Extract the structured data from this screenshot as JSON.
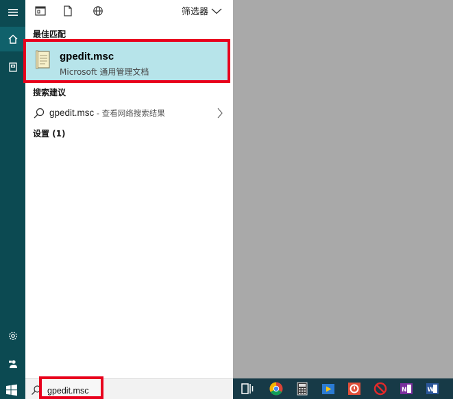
{
  "filters": {
    "label": "筛选器"
  },
  "best_match": {
    "header": "最佳匹配",
    "title": "gpedit.msc",
    "subtitle": "Microsoft 通用管理文档"
  },
  "suggestions": {
    "header": "搜索建议",
    "query": "gpedit.msc",
    "hint": " - 查看网络搜索结果"
  },
  "settings": {
    "header": "设置 (1)"
  },
  "search": {
    "value": "gpedit.msc"
  },
  "colors": {
    "rail": "#0c4a52",
    "highlight": "#b7e4ea",
    "annotation_red": "#e8001c",
    "taskbar": "#173a47",
    "desktop": "#a9a9a9"
  },
  "taskbar_icons": [
    "task-view-icon",
    "chrome-icon",
    "calculator-icon",
    "media-player-icon",
    "opera-icon",
    "no-entry-icon",
    "onenote-icon",
    "word-icon"
  ]
}
